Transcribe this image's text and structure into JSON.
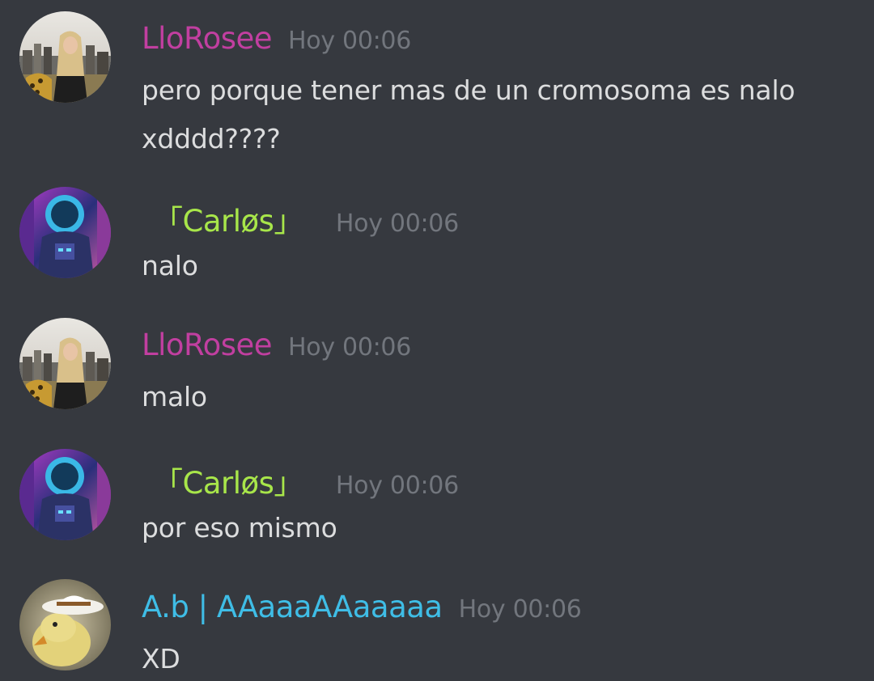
{
  "colors": {
    "background": "#36393f",
    "message_text": "#dcddde",
    "timestamp": "#72767d",
    "user_llorosee": "#c13fa0",
    "user_carlos": "#a8e64a",
    "user_ab": "#3fbde6"
  },
  "messages": [
    {
      "username": "LloRosee",
      "timestamp": "Hoy 00:06",
      "lines": [
        "pero porque tener mas de un cromosoma es nalo",
        "xdddd????"
      ],
      "avatar": "user-avatar-photo"
    },
    {
      "username": "「Carløs」",
      "timestamp": "Hoy 00:06",
      "lines": [
        "nalo"
      ],
      "avatar": "astronaut-avatar"
    },
    {
      "username": "LloRosee",
      "timestamp": "Hoy 00:06",
      "lines": [
        "malo"
      ],
      "avatar": "user-avatar-photo"
    },
    {
      "username": "「Carløs」",
      "timestamp": "Hoy 00:06",
      "lines": [
        "por eso mismo"
      ],
      "avatar": "astronaut-avatar"
    },
    {
      "username": "A.b | AAaaaAAaaaaa",
      "timestamp": "Hoy 00:06",
      "lines": [
        "XD"
      ],
      "avatar": "duck-cowboy-avatar"
    }
  ]
}
